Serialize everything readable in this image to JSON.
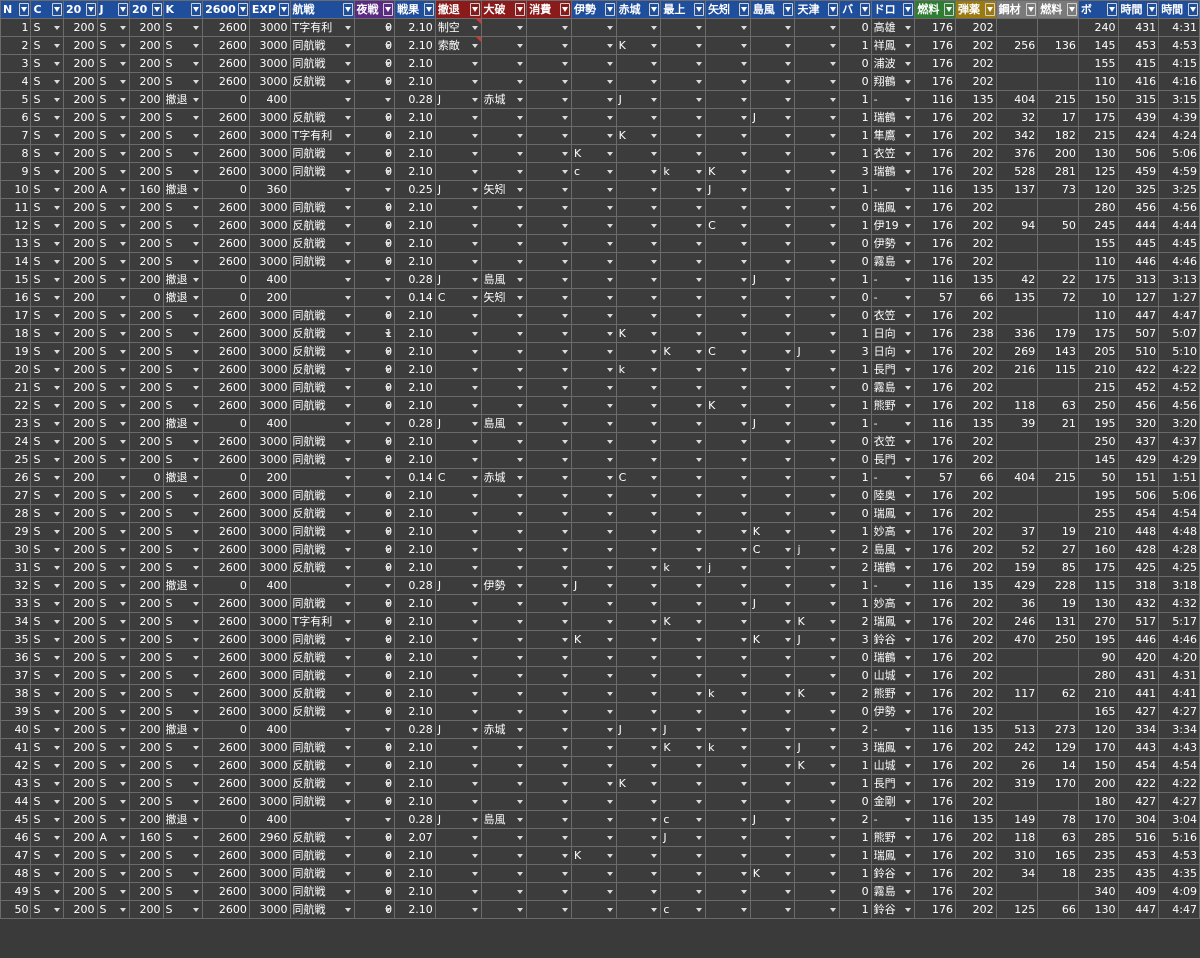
{
  "headers": [
    {
      "label": "N",
      "color": "#1f4e9c"
    },
    {
      "label": "C",
      "color": "#1f4e9c"
    },
    {
      "label": "20",
      "color": "#1f4e9c"
    },
    {
      "label": "J",
      "color": "#1f4e9c"
    },
    {
      "label": "20",
      "color": "#1f4e9c"
    },
    {
      "label": "K",
      "color": "#1f4e9c"
    },
    {
      "label": "2600",
      "color": "#1f4e9c"
    },
    {
      "label": "EXP",
      "color": "#1f4e9c"
    },
    {
      "label": "航戦",
      "color": "#1f4e9c"
    },
    {
      "label": "夜戦",
      "color": "#5b2b83"
    },
    {
      "label": "戦果",
      "color": "#1f4e9c"
    },
    {
      "label": "撤退",
      "color": "#8b1a1a"
    },
    {
      "label": "大破",
      "color": "#8b1a1a"
    },
    {
      "label": "消費",
      "color": "#8b1a1a"
    },
    {
      "label": "伊勢",
      "color": "#1f4e9c"
    },
    {
      "label": "赤城",
      "color": "#1f4e9c"
    },
    {
      "label": "最上",
      "color": "#1f4e9c"
    },
    {
      "label": "矢矧",
      "color": "#1f4e9c"
    },
    {
      "label": "島風",
      "color": "#1f4e9c"
    },
    {
      "label": "天津",
      "color": "#1f4e9c"
    },
    {
      "label": "バ",
      "color": "#1f4e9c"
    },
    {
      "label": "ドロ",
      "color": "#1f4e9c"
    },
    {
      "label": "燃料",
      "color": "#2e7d32"
    },
    {
      "label": "弾薬",
      "color": "#9c7a12"
    },
    {
      "label": "鋼材",
      "color": "#7a7a7a"
    },
    {
      "label": "燃料",
      "color": "#7a7a7a"
    },
    {
      "label": "ボ",
      "color": "#1f4e9c"
    },
    {
      "label": "時間",
      "color": "#1f4e9c"
    },
    {
      "label": "時間",
      "color": "#1f4e9c"
    }
  ],
  "rows": [
    [
      "1",
      "S",
      "200",
      "S",
      "200",
      "S",
      "2600",
      "3000",
      "T字有利",
      "0",
      "2.10",
      "制空",
      "",
      "",
      "",
      "",
      "",
      "",
      "",
      "",
      "0",
      "高雄",
      "176",
      "202",
      "",
      "",
      "240",
      "431",
      "4:31"
    ],
    [
      "2",
      "S",
      "200",
      "S",
      "200",
      "S",
      "2600",
      "3000",
      "同航戦",
      "0",
      "2.10",
      "索敵",
      "",
      "",
      "",
      "K",
      "",
      "",
      "",
      "",
      "1",
      "祥鳳",
      "176",
      "202",
      "256",
      "136",
      "145",
      "453",
      "4:53"
    ],
    [
      "3",
      "S",
      "200",
      "S",
      "200",
      "S",
      "2600",
      "3000",
      "同航戦",
      "0",
      "2.10",
      "",
      "",
      "",
      "",
      "",
      "",
      "",
      "",
      "",
      "0",
      "浦波",
      "176",
      "202",
      "",
      "",
      "155",
      "415",
      "4:15"
    ],
    [
      "4",
      "S",
      "200",
      "S",
      "200",
      "S",
      "2600",
      "3000",
      "反航戦",
      "0",
      "2.10",
      "",
      "",
      "",
      "",
      "",
      "",
      "",
      "",
      "",
      "0",
      "翔鶴",
      "176",
      "202",
      "",
      "",
      "110",
      "416",
      "4:16"
    ],
    [
      "5",
      "S",
      "200",
      "S",
      "200",
      "撤退",
      "0",
      "400",
      "",
      "",
      "0.28",
      "J",
      "赤城",
      "",
      "",
      "J",
      "",
      "",
      "",
      "",
      "1",
      "-",
      "116",
      "135",
      "404",
      "215",
      "150",
      "315",
      "3:15"
    ],
    [
      "6",
      "S",
      "200",
      "S",
      "200",
      "S",
      "2600",
      "3000",
      "反航戦",
      "0",
      "2.10",
      "",
      "",
      "",
      "",
      "",
      "",
      "",
      "J",
      "",
      "1",
      "瑞鶴",
      "176",
      "202",
      "32",
      "17",
      "175",
      "439",
      "4:39"
    ],
    [
      "7",
      "S",
      "200",
      "S",
      "200",
      "S",
      "2600",
      "3000",
      "T字有利",
      "0",
      "2.10",
      "",
      "",
      "",
      "",
      "K",
      "",
      "",
      "",
      "",
      "1",
      "隼鷹",
      "176",
      "202",
      "342",
      "182",
      "215",
      "424",
      "4:24"
    ],
    [
      "8",
      "S",
      "200",
      "S",
      "200",
      "S",
      "2600",
      "3000",
      "同航戦",
      "0",
      "2.10",
      "",
      "",
      "",
      "K",
      "",
      "",
      "",
      "",
      "",
      "1",
      "衣笠",
      "176",
      "202",
      "376",
      "200",
      "130",
      "506",
      "5:06"
    ],
    [
      "9",
      "S",
      "200",
      "S",
      "200",
      "S",
      "2600",
      "3000",
      "同航戦",
      "0",
      "2.10",
      "",
      "",
      "",
      "c",
      "",
      "k",
      "K",
      "",
      "",
      "3",
      "瑞鶴",
      "176",
      "202",
      "528",
      "281",
      "125",
      "459",
      "4:59"
    ],
    [
      "10",
      "S",
      "200",
      "A",
      "160",
      "撤退",
      "0",
      "360",
      "",
      "",
      "0.25",
      "J",
      "矢矧",
      "",
      "",
      "",
      "",
      "J",
      "",
      "",
      "1",
      "-",
      "116",
      "135",
      "137",
      "73",
      "120",
      "325",
      "3:25"
    ],
    [
      "11",
      "S",
      "200",
      "S",
      "200",
      "S",
      "2600",
      "3000",
      "同航戦",
      "0",
      "2.10",
      "",
      "",
      "",
      "",
      "",
      "",
      "",
      "",
      "",
      "0",
      "瑞鳳",
      "176",
      "202",
      "",
      "",
      "280",
      "456",
      "4:56"
    ],
    [
      "12",
      "S",
      "200",
      "S",
      "200",
      "S",
      "2600",
      "3000",
      "反航戦",
      "0",
      "2.10",
      "",
      "",
      "",
      "",
      "",
      "",
      "C",
      "",
      "",
      "1",
      "伊19",
      "176",
      "202",
      "94",
      "50",
      "245",
      "444",
      "4:44"
    ],
    [
      "13",
      "S",
      "200",
      "S",
      "200",
      "S",
      "2600",
      "3000",
      "反航戦",
      "0",
      "2.10",
      "",
      "",
      "",
      "",
      "",
      "",
      "",
      "",
      "",
      "0",
      "伊勢",
      "176",
      "202",
      "",
      "",
      "155",
      "445",
      "4:45"
    ],
    [
      "14",
      "S",
      "200",
      "S",
      "200",
      "S",
      "2600",
      "3000",
      "同航戦",
      "0",
      "2.10",
      "",
      "",
      "",
      "",
      "",
      "",
      "",
      "",
      "",
      "0",
      "霧島",
      "176",
      "202",
      "",
      "",
      "110",
      "446",
      "4:46"
    ],
    [
      "15",
      "S",
      "200",
      "S",
      "200",
      "撤退",
      "0",
      "400",
      "",
      "",
      "0.28",
      "J",
      "島風",
      "",
      "",
      "",
      "",
      "",
      "J",
      "",
      "1",
      "-",
      "116",
      "135",
      "42",
      "22",
      "175",
      "313",
      "3:13"
    ],
    [
      "16",
      "S",
      "200",
      "",
      "0",
      "撤退",
      "0",
      "200",
      "",
      "",
      "0.14",
      "C",
      "矢矧",
      "",
      "",
      "",
      "",
      "",
      "",
      "",
      "0",
      "-",
      "57",
      "66",
      "135",
      "72",
      "10",
      "127",
      "1:27"
    ],
    [
      "17",
      "S",
      "200",
      "S",
      "200",
      "S",
      "2600",
      "3000",
      "同航戦",
      "0",
      "2.10",
      "",
      "",
      "",
      "",
      "",
      "",
      "",
      "",
      "",
      "0",
      "衣笠",
      "176",
      "202",
      "",
      "",
      "110",
      "447",
      "4:47"
    ],
    [
      "18",
      "S",
      "200",
      "S",
      "200",
      "S",
      "2600",
      "3000",
      "反航戦",
      "1",
      "2.10",
      "",
      "",
      "",
      "",
      "K",
      "",
      "",
      "",
      "",
      "1",
      "日向",
      "176",
      "238",
      "336",
      "179",
      "175",
      "507",
      "5:07"
    ],
    [
      "19",
      "S",
      "200",
      "S",
      "200",
      "S",
      "2600",
      "3000",
      "反航戦",
      "0",
      "2.10",
      "",
      "",
      "",
      "",
      "",
      "K",
      "C",
      "",
      "J",
      "3",
      "日向",
      "176",
      "202",
      "269",
      "143",
      "205",
      "510",
      "5:10"
    ],
    [
      "20",
      "S",
      "200",
      "S",
      "200",
      "S",
      "2600",
      "3000",
      "反航戦",
      "0",
      "2.10",
      "",
      "",
      "",
      "",
      "k",
      "",
      "",
      "",
      "",
      "1",
      "長門",
      "176",
      "202",
      "216",
      "115",
      "210",
      "422",
      "4:22"
    ],
    [
      "21",
      "S",
      "200",
      "S",
      "200",
      "S",
      "2600",
      "3000",
      "同航戦",
      "0",
      "2.10",
      "",
      "",
      "",
      "",
      "",
      "",
      "",
      "",
      "",
      "0",
      "霧島",
      "176",
      "202",
      "",
      "",
      "215",
      "452",
      "4:52"
    ],
    [
      "22",
      "S",
      "200",
      "S",
      "200",
      "S",
      "2600",
      "3000",
      "同航戦",
      "0",
      "2.10",
      "",
      "",
      "",
      "",
      "",
      "",
      "K",
      "",
      "",
      "1",
      "熊野",
      "176",
      "202",
      "118",
      "63",
      "250",
      "456",
      "4:56"
    ],
    [
      "23",
      "S",
      "200",
      "S",
      "200",
      "撤退",
      "0",
      "400",
      "",
      "",
      "0.28",
      "J",
      "島風",
      "",
      "",
      "",
      "",
      "",
      "J",
      "",
      "1",
      "-",
      "116",
      "135",
      "39",
      "21",
      "195",
      "320",
      "3:20"
    ],
    [
      "24",
      "S",
      "200",
      "S",
      "200",
      "S",
      "2600",
      "3000",
      "同航戦",
      "0",
      "2.10",
      "",
      "",
      "",
      "",
      "",
      "",
      "",
      "",
      "",
      "0",
      "衣笠",
      "176",
      "202",
      "",
      "",
      "250",
      "437",
      "4:37"
    ],
    [
      "25",
      "S",
      "200",
      "S",
      "200",
      "S",
      "2600",
      "3000",
      "同航戦",
      "0",
      "2.10",
      "",
      "",
      "",
      "",
      "",
      "",
      "",
      "",
      "",
      "0",
      "長門",
      "176",
      "202",
      "",
      "",
      "145",
      "429",
      "4:29"
    ],
    [
      "26",
      "S",
      "200",
      "",
      "0",
      "撤退",
      "0",
      "200",
      "",
      "",
      "0.14",
      "C",
      "赤城",
      "",
      "",
      "C",
      "",
      "",
      "",
      "",
      "1",
      "-",
      "57",
      "66",
      "404",
      "215",
      "50",
      "151",
      "1:51"
    ],
    [
      "27",
      "S",
      "200",
      "S",
      "200",
      "S",
      "2600",
      "3000",
      "同航戦",
      "0",
      "2.10",
      "",
      "",
      "",
      "",
      "",
      "",
      "",
      "",
      "",
      "0",
      "陸奥",
      "176",
      "202",
      "",
      "",
      "195",
      "506",
      "5:06"
    ],
    [
      "28",
      "S",
      "200",
      "S",
      "200",
      "S",
      "2600",
      "3000",
      "反航戦",
      "0",
      "2.10",
      "",
      "",
      "",
      "",
      "",
      "",
      "",
      "",
      "",
      "0",
      "瑞鳳",
      "176",
      "202",
      "",
      "",
      "255",
      "454",
      "4:54"
    ],
    [
      "29",
      "S",
      "200",
      "S",
      "200",
      "S",
      "2600",
      "3000",
      "同航戦",
      "0",
      "2.10",
      "",
      "",
      "",
      "",
      "",
      "",
      "",
      "K",
      "",
      "1",
      "妙高",
      "176",
      "202",
      "37",
      "19",
      "210",
      "448",
      "4:48"
    ],
    [
      "30",
      "S",
      "200",
      "S",
      "200",
      "S",
      "2600",
      "3000",
      "同航戦",
      "0",
      "2.10",
      "",
      "",
      "",
      "",
      "",
      "",
      "",
      "C",
      "j",
      "2",
      "島風",
      "176",
      "202",
      "52",
      "27",
      "160",
      "428",
      "4:28"
    ],
    [
      "31",
      "S",
      "200",
      "S",
      "200",
      "S",
      "2600",
      "3000",
      "反航戦",
      "0",
      "2.10",
      "",
      "",
      "",
      "",
      "",
      "k",
      "j",
      "",
      "",
      "2",
      "瑞鶴",
      "176",
      "202",
      "159",
      "85",
      "175",
      "425",
      "4:25"
    ],
    [
      "32",
      "S",
      "200",
      "S",
      "200",
      "撤退",
      "0",
      "400",
      "",
      "",
      "0.28",
      "J",
      "伊勢",
      "",
      "J",
      "",
      "",
      "",
      "",
      "",
      "1",
      "-",
      "116",
      "135",
      "429",
      "228",
      "115",
      "318",
      "3:18"
    ],
    [
      "33",
      "S",
      "200",
      "S",
      "200",
      "S",
      "2600",
      "3000",
      "同航戦",
      "0",
      "2.10",
      "",
      "",
      "",
      "",
      "",
      "",
      "",
      "J",
      "",
      "1",
      "妙高",
      "176",
      "202",
      "36",
      "19",
      "130",
      "432",
      "4:32"
    ],
    [
      "34",
      "S",
      "200",
      "S",
      "200",
      "S",
      "2600",
      "3000",
      "T字有利",
      "0",
      "2.10",
      "",
      "",
      "",
      "",
      "",
      "K",
      "",
      "",
      "K",
      "2",
      "瑞鳳",
      "176",
      "202",
      "246",
      "131",
      "270",
      "517",
      "5:17"
    ],
    [
      "35",
      "S",
      "200",
      "S",
      "200",
      "S",
      "2600",
      "3000",
      "同航戦",
      "0",
      "2.10",
      "",
      "",
      "",
      "K",
      "",
      "",
      "",
      "K",
      "J",
      "3",
      "鈴谷",
      "176",
      "202",
      "470",
      "250",
      "195",
      "446",
      "4:46"
    ],
    [
      "36",
      "S",
      "200",
      "S",
      "200",
      "S",
      "2600",
      "3000",
      "反航戦",
      "0",
      "2.10",
      "",
      "",
      "",
      "",
      "",
      "",
      "",
      "",
      "",
      "0",
      "瑞鶴",
      "176",
      "202",
      "",
      "",
      "90",
      "420",
      "4:20"
    ],
    [
      "37",
      "S",
      "200",
      "S",
      "200",
      "S",
      "2600",
      "3000",
      "同航戦",
      "0",
      "2.10",
      "",
      "",
      "",
      "",
      "",
      "",
      "",
      "",
      "",
      "0",
      "山城",
      "176",
      "202",
      "",
      "",
      "280",
      "431",
      "4:31"
    ],
    [
      "38",
      "S",
      "200",
      "S",
      "200",
      "S",
      "2600",
      "3000",
      "反航戦",
      "0",
      "2.10",
      "",
      "",
      "",
      "",
      "",
      "",
      "k",
      "",
      "K",
      "2",
      "熊野",
      "176",
      "202",
      "117",
      "62",
      "210",
      "441",
      "4:41"
    ],
    [
      "39",
      "S",
      "200",
      "S",
      "200",
      "S",
      "2600",
      "3000",
      "反航戦",
      "0",
      "2.10",
      "",
      "",
      "",
      "",
      "",
      "",
      "",
      "",
      "",
      "0",
      "伊勢",
      "176",
      "202",
      "",
      "",
      "165",
      "427",
      "4:27"
    ],
    [
      "40",
      "S",
      "200",
      "S",
      "200",
      "撤退",
      "0",
      "400",
      "",
      "",
      "0.28",
      "J",
      "赤城",
      "",
      "",
      "J",
      "J",
      "",
      "",
      "",
      "2",
      "-",
      "116",
      "135",
      "513",
      "273",
      "120",
      "334",
      "3:34"
    ],
    [
      "41",
      "S",
      "200",
      "S",
      "200",
      "S",
      "2600",
      "3000",
      "同航戦",
      "0",
      "2.10",
      "",
      "",
      "",
      "",
      "",
      "K",
      "k",
      "",
      "J",
      "3",
      "瑞鳳",
      "176",
      "202",
      "242",
      "129",
      "170",
      "443",
      "4:43"
    ],
    [
      "42",
      "S",
      "200",
      "S",
      "200",
      "S",
      "2600",
      "3000",
      "反航戦",
      "0",
      "2.10",
      "",
      "",
      "",
      "",
      "",
      "",
      "",
      "",
      "K",
      "1",
      "山城",
      "176",
      "202",
      "26",
      "14",
      "150",
      "454",
      "4:54"
    ],
    [
      "43",
      "S",
      "200",
      "S",
      "200",
      "S",
      "2600",
      "3000",
      "反航戦",
      "0",
      "2.10",
      "",
      "",
      "",
      "",
      "K",
      "",
      "",
      "",
      "",
      "1",
      "長門",
      "176",
      "202",
      "319",
      "170",
      "200",
      "422",
      "4:22"
    ],
    [
      "44",
      "S",
      "200",
      "S",
      "200",
      "S",
      "2600",
      "3000",
      "同航戦",
      "0",
      "2.10",
      "",
      "",
      "",
      "",
      "",
      "",
      "",
      "",
      "",
      "0",
      "金剛",
      "176",
      "202",
      "",
      "",
      "180",
      "427",
      "4:27"
    ],
    [
      "45",
      "S",
      "200",
      "S",
      "200",
      "撤退",
      "0",
      "400",
      "",
      "",
      "0.28",
      "J",
      "島風",
      "",
      "",
      "",
      "c",
      "",
      "J",
      "",
      "2",
      "-",
      "116",
      "135",
      "149",
      "78",
      "170",
      "304",
      "3:04"
    ],
    [
      "46",
      "S",
      "200",
      "A",
      "160",
      "S",
      "2600",
      "2960",
      "反航戦",
      "0",
      "2.07",
      "",
      "",
      "",
      "",
      "",
      "J",
      "",
      "",
      "",
      "1",
      "熊野",
      "176",
      "202",
      "118",
      "63",
      "285",
      "516",
      "5:16"
    ],
    [
      "47",
      "S",
      "200",
      "S",
      "200",
      "S",
      "2600",
      "3000",
      "同航戦",
      "0",
      "2.10",
      "",
      "",
      "",
      "K",
      "",
      "",
      "",
      "",
      "",
      "1",
      "瑞鳳",
      "176",
      "202",
      "310",
      "165",
      "235",
      "453",
      "4:53"
    ],
    [
      "48",
      "S",
      "200",
      "S",
      "200",
      "S",
      "2600",
      "3000",
      "同航戦",
      "0",
      "2.10",
      "",
      "",
      "",
      "",
      "",
      "",
      "",
      "K",
      "",
      "1",
      "鈴谷",
      "176",
      "202",
      "34",
      "18",
      "235",
      "435",
      "4:35"
    ],
    [
      "49",
      "S",
      "200",
      "S",
      "200",
      "S",
      "2600",
      "3000",
      "同航戦",
      "0",
      "2.10",
      "",
      "",
      "",
      "",
      "",
      "",
      "",
      "",
      "",
      "0",
      "霧島",
      "176",
      "202",
      "",
      "",
      "340",
      "409",
      "4:09"
    ],
    [
      "50",
      "S",
      "200",
      "S",
      "200",
      "S",
      "2600",
      "3000",
      "同航戦",
      "0",
      "2.10",
      "",
      "",
      "",
      "",
      "",
      "c",
      "",
      "",
      "",
      "1",
      "鈴谷",
      "176",
      "202",
      "125",
      "66",
      "130",
      "447",
      "4:47"
    ]
  ]
}
